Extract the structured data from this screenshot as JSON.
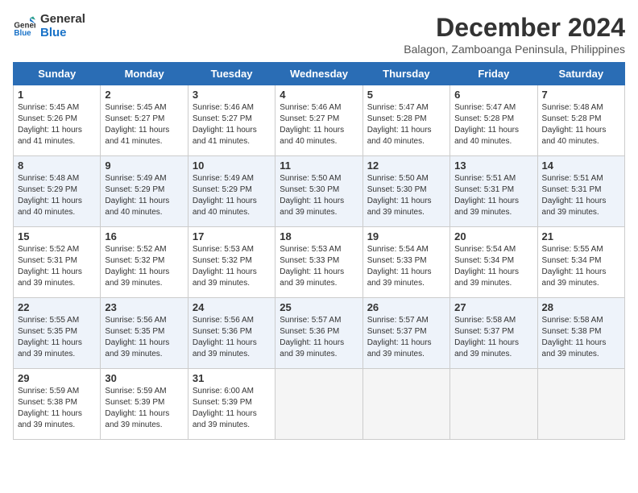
{
  "logo": {
    "line1": "General",
    "line2": "Blue"
  },
  "title": "December 2024",
  "location": "Balagon, Zamboanga Peninsula, Philippines",
  "weekdays": [
    "Sunday",
    "Monday",
    "Tuesday",
    "Wednesday",
    "Thursday",
    "Friday",
    "Saturday"
  ],
  "weeks": [
    [
      {
        "day": "1",
        "sunrise": "5:45 AM",
        "sunset": "5:26 PM",
        "daylight": "11 hours and 41 minutes."
      },
      {
        "day": "2",
        "sunrise": "5:45 AM",
        "sunset": "5:27 PM",
        "daylight": "11 hours and 41 minutes."
      },
      {
        "day": "3",
        "sunrise": "5:46 AM",
        "sunset": "5:27 PM",
        "daylight": "11 hours and 41 minutes."
      },
      {
        "day": "4",
        "sunrise": "5:46 AM",
        "sunset": "5:27 PM",
        "daylight": "11 hours and 40 minutes."
      },
      {
        "day": "5",
        "sunrise": "5:47 AM",
        "sunset": "5:28 PM",
        "daylight": "11 hours and 40 minutes."
      },
      {
        "day": "6",
        "sunrise": "5:47 AM",
        "sunset": "5:28 PM",
        "daylight": "11 hours and 40 minutes."
      },
      {
        "day": "7",
        "sunrise": "5:48 AM",
        "sunset": "5:28 PM",
        "daylight": "11 hours and 40 minutes."
      }
    ],
    [
      {
        "day": "8",
        "sunrise": "5:48 AM",
        "sunset": "5:29 PM",
        "daylight": "11 hours and 40 minutes."
      },
      {
        "day": "9",
        "sunrise": "5:49 AM",
        "sunset": "5:29 PM",
        "daylight": "11 hours and 40 minutes."
      },
      {
        "day": "10",
        "sunrise": "5:49 AM",
        "sunset": "5:29 PM",
        "daylight": "11 hours and 40 minutes."
      },
      {
        "day": "11",
        "sunrise": "5:50 AM",
        "sunset": "5:30 PM",
        "daylight": "11 hours and 39 minutes."
      },
      {
        "day": "12",
        "sunrise": "5:50 AM",
        "sunset": "5:30 PM",
        "daylight": "11 hours and 39 minutes."
      },
      {
        "day": "13",
        "sunrise": "5:51 AM",
        "sunset": "5:31 PM",
        "daylight": "11 hours and 39 minutes."
      },
      {
        "day": "14",
        "sunrise": "5:51 AM",
        "sunset": "5:31 PM",
        "daylight": "11 hours and 39 minutes."
      }
    ],
    [
      {
        "day": "15",
        "sunrise": "5:52 AM",
        "sunset": "5:31 PM",
        "daylight": "11 hours and 39 minutes."
      },
      {
        "day": "16",
        "sunrise": "5:52 AM",
        "sunset": "5:32 PM",
        "daylight": "11 hours and 39 minutes."
      },
      {
        "day": "17",
        "sunrise": "5:53 AM",
        "sunset": "5:32 PM",
        "daylight": "11 hours and 39 minutes."
      },
      {
        "day": "18",
        "sunrise": "5:53 AM",
        "sunset": "5:33 PM",
        "daylight": "11 hours and 39 minutes."
      },
      {
        "day": "19",
        "sunrise": "5:54 AM",
        "sunset": "5:33 PM",
        "daylight": "11 hours and 39 minutes."
      },
      {
        "day": "20",
        "sunrise": "5:54 AM",
        "sunset": "5:34 PM",
        "daylight": "11 hours and 39 minutes."
      },
      {
        "day": "21",
        "sunrise": "5:55 AM",
        "sunset": "5:34 PM",
        "daylight": "11 hours and 39 minutes."
      }
    ],
    [
      {
        "day": "22",
        "sunrise": "5:55 AM",
        "sunset": "5:35 PM",
        "daylight": "11 hours and 39 minutes."
      },
      {
        "day": "23",
        "sunrise": "5:56 AM",
        "sunset": "5:35 PM",
        "daylight": "11 hours and 39 minutes."
      },
      {
        "day": "24",
        "sunrise": "5:56 AM",
        "sunset": "5:36 PM",
        "daylight": "11 hours and 39 minutes."
      },
      {
        "day": "25",
        "sunrise": "5:57 AM",
        "sunset": "5:36 PM",
        "daylight": "11 hours and 39 minutes."
      },
      {
        "day": "26",
        "sunrise": "5:57 AM",
        "sunset": "5:37 PM",
        "daylight": "11 hours and 39 minutes."
      },
      {
        "day": "27",
        "sunrise": "5:58 AM",
        "sunset": "5:37 PM",
        "daylight": "11 hours and 39 minutes."
      },
      {
        "day": "28",
        "sunrise": "5:58 AM",
        "sunset": "5:38 PM",
        "daylight": "11 hours and 39 minutes."
      }
    ],
    [
      {
        "day": "29",
        "sunrise": "5:59 AM",
        "sunset": "5:38 PM",
        "daylight": "11 hours and 39 minutes."
      },
      {
        "day": "30",
        "sunrise": "5:59 AM",
        "sunset": "5:39 PM",
        "daylight": "11 hours and 39 minutes."
      },
      {
        "day": "31",
        "sunrise": "6:00 AM",
        "sunset": "5:39 PM",
        "daylight": "11 hours and 39 minutes."
      },
      null,
      null,
      null,
      null
    ]
  ],
  "labels": {
    "sunrise": "Sunrise: ",
    "sunset": "Sunset: ",
    "daylight": "Daylight: "
  }
}
